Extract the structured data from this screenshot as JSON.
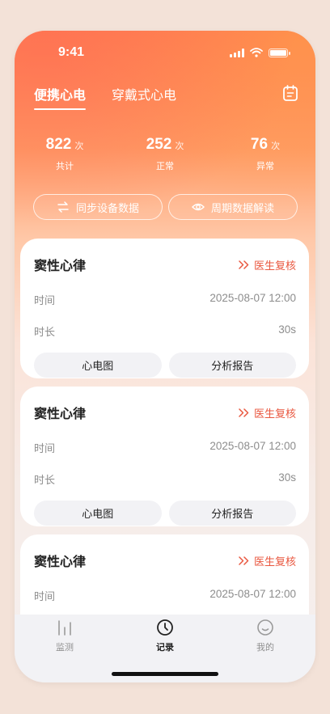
{
  "status": {
    "time": "9:41"
  },
  "tabs": [
    {
      "label": "便携心电",
      "active": true
    },
    {
      "label": "穿戴式心电",
      "active": false
    }
  ],
  "stats": [
    {
      "value": "822",
      "unit": "次",
      "label": "共计"
    },
    {
      "value": "252",
      "unit": "次",
      "label": "正常"
    },
    {
      "value": "76",
      "unit": "次",
      "label": "异常"
    }
  ],
  "actions": {
    "sync_label": "同步设备数据",
    "cycle_label": "周期数据解读"
  },
  "records": [
    {
      "title": "窦性心律",
      "review": "医生复核",
      "time_label": "时间",
      "time_value": "2025-08-07 12:00",
      "duration_label": "时长",
      "duration_value": "30s",
      "ecg_button": "心电图",
      "report_button": "分析报告"
    },
    {
      "title": "窦性心律",
      "review": "医生复核",
      "time_label": "时间",
      "time_value": "2025-08-07 12:00",
      "duration_label": "时长",
      "duration_value": "30s",
      "ecg_button": "心电图",
      "report_button": "分析报告"
    },
    {
      "title": "窦性心律",
      "review": "医生复核",
      "time_label": "时间",
      "time_value": "2025-08-07 12:00"
    }
  ],
  "tabbar": [
    {
      "label": "监测",
      "icon": "bars-icon",
      "active": false
    },
    {
      "label": "记录",
      "icon": "clock-icon",
      "active": true
    },
    {
      "label": "我的",
      "icon": "smile-icon",
      "active": false
    }
  ],
  "colors": {
    "accent": "#e9573f",
    "gradient_top": "#ff7a55",
    "gradient_mid": "#ff9a66",
    "card_button_bg": "#f2f2f5"
  }
}
